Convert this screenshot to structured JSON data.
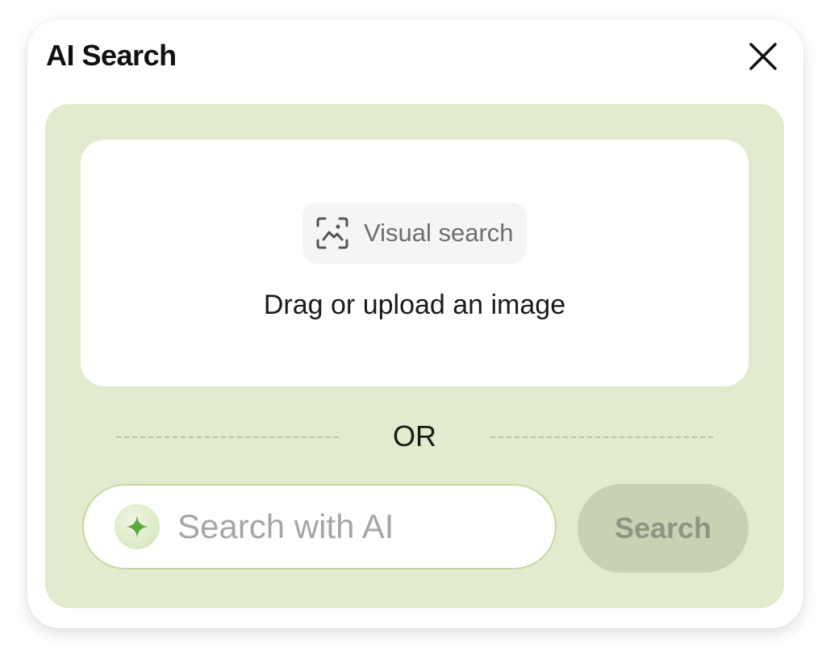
{
  "dialog": {
    "title": "AI Search",
    "close_icon": "close-icon"
  },
  "dropzone": {
    "chip_icon": "visual-search-icon",
    "chip_label": "Visual search",
    "instruction": "Drag or upload an image"
  },
  "divider": {
    "label": "OR"
  },
  "search": {
    "sparkle_icon": "sparkle-icon",
    "placeholder": "Search with AI",
    "value": "",
    "button_label": "Search"
  },
  "colors": {
    "panel_bg": "#e2ebcd",
    "sparkle": "#5aaa3c",
    "button_bg": "#c8d2b2",
    "button_text": "#8c9684"
  }
}
